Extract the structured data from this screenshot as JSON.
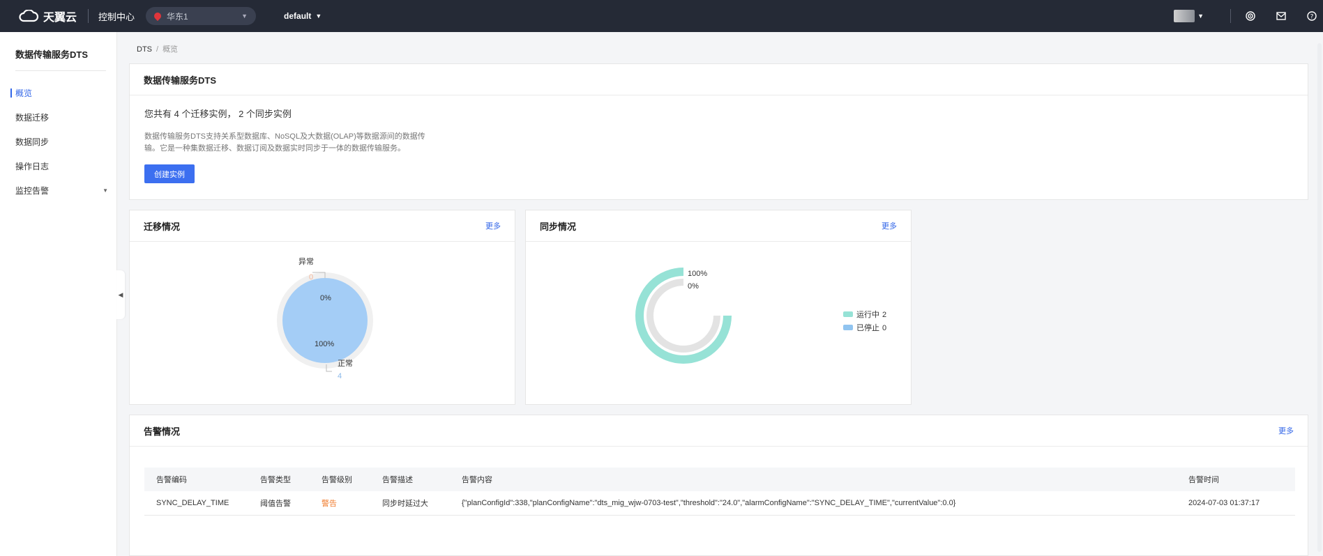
{
  "topbar": {
    "logo_text": "天翼云",
    "console": "控制中心",
    "region": "华东1",
    "project": "default"
  },
  "sidebar": {
    "title": "数据传输服务DTS",
    "items": [
      {
        "label": "概览"
      },
      {
        "label": "数据迁移"
      },
      {
        "label": "数据同步"
      },
      {
        "label": "操作日志"
      },
      {
        "label": "监控告警"
      }
    ]
  },
  "breadcrumb": {
    "root": "DTS",
    "sep": "/",
    "current": "概览"
  },
  "overview": {
    "title": "数据传输服务DTS",
    "count_text": "您共有 4 个迁移实例， 2 个同步实例",
    "desc_line1": "数据传输服务DTS支持关系型数据库、NoSQL及大数据(OLAP)等数据源间的数据传",
    "desc_line2": "输。它是一种集数据迁移、数据订阅及数据实时同步于一体的数据传输服务。",
    "create_button": "创建实例"
  },
  "migration": {
    "title": "迁移情况",
    "more": "更多",
    "chart": {
      "abnormal_label": "异常",
      "abnormal_value": "0",
      "abnormal_pct": "0%",
      "normal_label": "正常",
      "normal_value": "4",
      "normal_pct": "100%"
    }
  },
  "sync": {
    "title": "同步情况",
    "more": "更多",
    "chart": {
      "outer_pct": "100%",
      "inner_pct": "0%",
      "legend_running": "运行中",
      "running_count": "2",
      "legend_stopped": "已停止",
      "stopped_count": "0"
    }
  },
  "alarm": {
    "title": "告警情况",
    "more": "更多",
    "columns": [
      "告警编码",
      "告警类型",
      "告警级别",
      "告警描述",
      "告警内容",
      "告警时间"
    ],
    "rows": [
      {
        "code": "SYNC_DELAY_TIME",
        "type": "阈值告警",
        "level": "警告",
        "desc": "同步时延过大",
        "content": "{\"planConfigId\":338,\"planConfigName\":\"dts_mig_wjw-0703-test\",\"threshold\":\"24.0\",\"alarmConfigName\":\"SYNC_DELAY_TIME\",\"currentValue\":0.0}",
        "time": "2024-07-03 01:37:17"
      }
    ]
  },
  "chart_data": [
    {
      "type": "pie",
      "categories": [
        "异常",
        "正常"
      ],
      "values": [
        0,
        4
      ],
      "percents": [
        "0%",
        "100%"
      ]
    },
    {
      "type": "pie",
      "categories": [
        "运行中",
        "已停止"
      ],
      "values": [
        2,
        0
      ],
      "percents": [
        "100%",
        "0%"
      ]
    }
  ],
  "colors": {
    "topbar_bg": "#252a36",
    "accent": "#3266e8",
    "pie_blue": "#a4cdf6",
    "ring_teal": "#96e2d6",
    "legend_blue": "#90c4f0",
    "warn": "#f07c2e"
  },
  "icons": [
    "cloud-logo-icon",
    "location-pin-icon",
    "target-icon",
    "mail-icon",
    "help-icon"
  ]
}
